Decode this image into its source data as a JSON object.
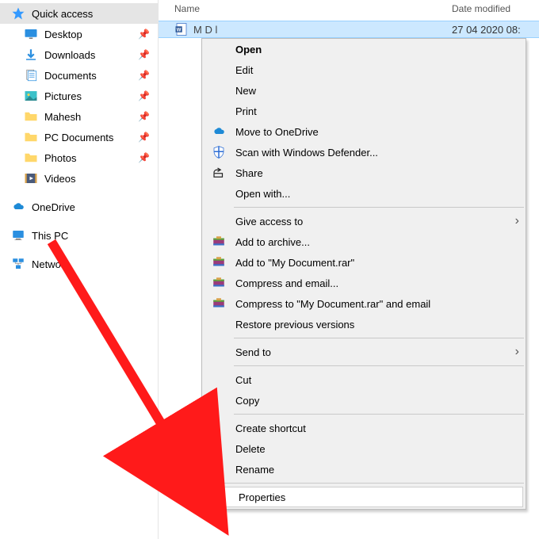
{
  "headers": {
    "name": "Name",
    "date": "Date modified"
  },
  "file": {
    "name": "M   D               l",
    "date_partial": "27 04 2020  08:"
  },
  "sidebar": {
    "quick_access": "Quick access",
    "desktop": "Desktop",
    "downloads": "Downloads",
    "documents": "Documents",
    "pictures": "Pictures",
    "mahesh": "Mahesh",
    "pc_documents": "PC Documents",
    "photos": "Photos",
    "videos": "Videos",
    "onedrive": "OneDrive",
    "this_pc": "This PC",
    "network": "Network"
  },
  "menu": {
    "open": "Open",
    "edit": "Edit",
    "new": "New",
    "print": "Print",
    "move_onedrive": "Move to OneDrive",
    "scan_defender": "Scan with Windows Defender...",
    "share": "Share",
    "open_with": "Open with...",
    "give_access": "Give access to",
    "add_archive": "Add to archive...",
    "add_rar": "Add to \"My Document.rar\"",
    "compress_email": "Compress and email...",
    "compress_rar_email": "Compress to \"My Document.rar\" and email",
    "restore_previous": "Restore previous versions",
    "send_to": "Send to",
    "cut": "Cut",
    "copy": "Copy",
    "create_shortcut": "Create shortcut",
    "delete": "Delete",
    "rename": "Rename",
    "properties": "Properties"
  }
}
